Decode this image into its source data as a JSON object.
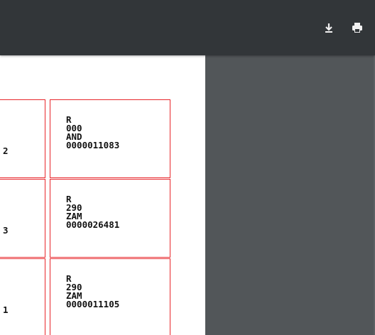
{
  "toolbar": {
    "download_icon": "download-icon",
    "print_icon": "print-icon"
  },
  "labels": [
    {
      "line1": "R",
      "line2": "000",
      "line3": "AND",
      "line4": "0000011083",
      "left_fragment": "2"
    },
    {
      "line1": "R",
      "line2": "290",
      "line3": "ZAM",
      "line4": "0000026481",
      "left_fragment": "3"
    },
    {
      "line1": "R",
      "line2": "290",
      "line3": "ZAM",
      "line4": "0000011105",
      "left_fragment": "1"
    }
  ],
  "colors": {
    "toolbar_bg": "#323639",
    "viewer_bg": "#525659",
    "page_bg": "#ffffff",
    "label_border": "#e8262b"
  }
}
